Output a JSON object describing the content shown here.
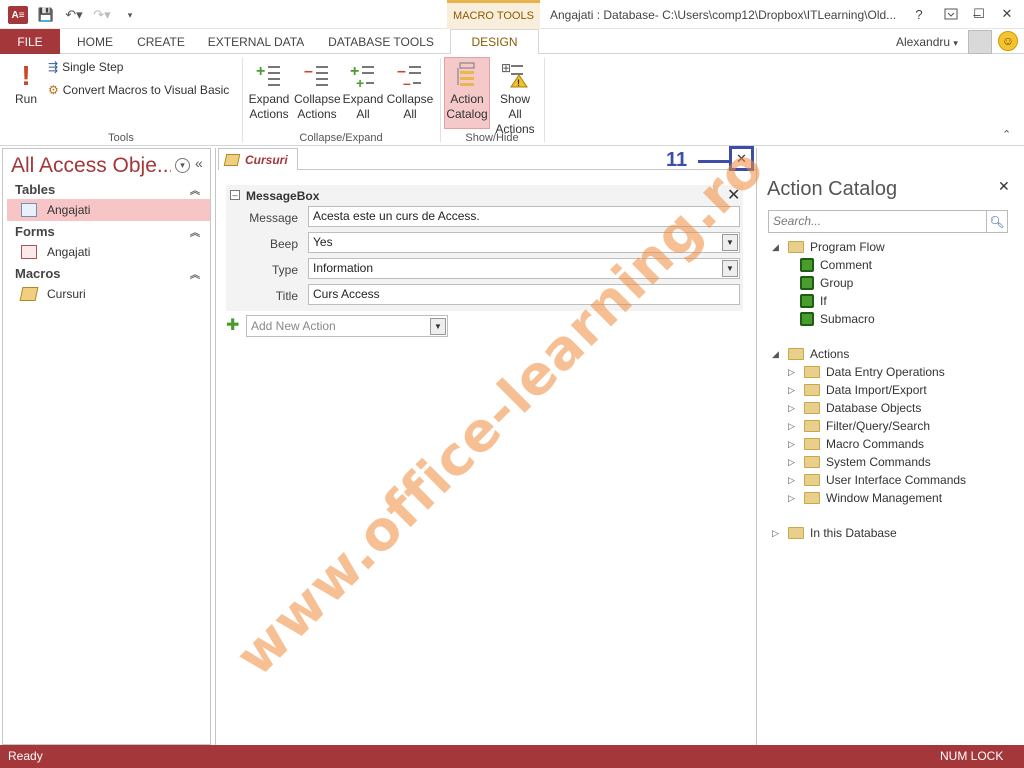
{
  "titlebar": {
    "context_tab": "MACRO TOOLS",
    "window_title": "Angajati : Database- C:\\Users\\comp12\\Dropbox\\ITLearning\\Old...",
    "help": "?",
    "minimize": "–",
    "restore": "☐",
    "close": "✕"
  },
  "tabs": {
    "file": "FILE",
    "home": "HOME",
    "create": "CREATE",
    "external": "EXTERNAL DATA",
    "dbtools": "DATABASE TOOLS",
    "design": "DESIGN"
  },
  "user": "Alexandru",
  "ribbon": {
    "run": "Run",
    "single_step": "Single Step",
    "convert": "Convert Macros to Visual Basic",
    "tools": "Tools",
    "expand_actions": [
      "Expand",
      "Actions"
    ],
    "collapse_actions": [
      "Collapse",
      "Actions"
    ],
    "expand_all": [
      "Expand",
      "All"
    ],
    "collapse_all": [
      "Collapse",
      "All"
    ],
    "collapse_expand": "Collapse/Expand",
    "action_catalog": [
      "Action",
      "Catalog"
    ],
    "show_all_actions": [
      "Show All",
      "Actions"
    ],
    "show_hide": "Show/Hide"
  },
  "nav": {
    "title": "All Access Obje...",
    "tables": "Tables",
    "table_item": "Angajati",
    "forms": "Forms",
    "form_item": "Angajati",
    "macros": "Macros",
    "macro_item": "Cursuri"
  },
  "doc": {
    "tab": "Cursuri",
    "callout": "11",
    "block_name": "MessageBox",
    "fields": [
      {
        "label": "Message",
        "value": "Acesta este un curs de Access."
      },
      {
        "label": "Beep",
        "value": "Yes"
      },
      {
        "label": "Type",
        "value": "Information"
      },
      {
        "label": "Title",
        "value": "Curs Access"
      }
    ],
    "add_action": "Add New Action"
  },
  "catalog": {
    "title": "Action Catalog",
    "search_placeholder": "Search...",
    "program_flow": "Program Flow",
    "flow_items": [
      "Comment",
      "Group",
      "If",
      "Submacro"
    ],
    "actions": "Actions",
    "action_items": [
      "Data Entry Operations",
      "Data Import/Export",
      "Database Objects",
      "Filter/Query/Search",
      "Macro Commands",
      "System Commands",
      "User Interface Commands",
      "Window Management"
    ],
    "in_db": "In this Database"
  },
  "status": {
    "left": "Ready",
    "right": "NUM LOCK"
  },
  "watermark": "www.office-learning.ro"
}
